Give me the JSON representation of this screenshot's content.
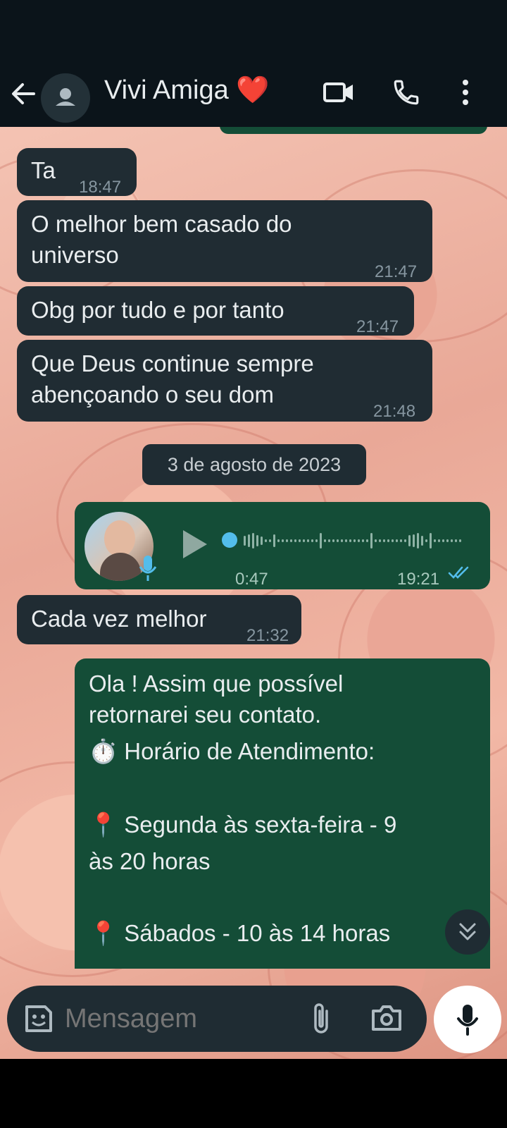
{
  "header": {
    "title": "Vivi Amiga",
    "title_emoji": "❤️"
  },
  "messages": [
    {
      "direction": "in",
      "text": "Ta",
      "time": "18:47"
    },
    {
      "direction": "in",
      "text_lines": [
        "O melhor bem casado do",
        "universo"
      ],
      "time": "21:47"
    },
    {
      "direction": "in",
      "text": "Obg por tudo e por tanto",
      "time": "21:47"
    },
    {
      "direction": "in",
      "text_lines": [
        "Que Deus continue sempre",
        "abençoando o seu dom"
      ],
      "time": "21:48"
    }
  ],
  "date_separator": "3 de agosto de 2023",
  "voice_message": {
    "direction": "out",
    "duration": "0:47",
    "time": "19:21",
    "status": "read"
  },
  "message_after_voice": {
    "direction": "in",
    "text": "Cada vez melhor",
    "time": "21:32"
  },
  "auto_reply": {
    "direction": "out",
    "lines": [
      "Ola ! Assim que possível",
      "retornarei seu contato.",
      "Horário de Atendimento:",
      "Segunda às sexta-feira - 9",
      "às 20 horas",
      "Sábados - 10 às 14 horas"
    ],
    "emojis": {
      "timer": "⏱️",
      "pin": "📍"
    }
  },
  "composer": {
    "placeholder": "Mensagem"
  },
  "icons": [
    "back-arrow-icon",
    "person-icon",
    "video-call-icon",
    "phone-icon",
    "more-vert-icon",
    "play-icon",
    "mic-badge-icon",
    "double-check-icon",
    "chevron-double-down-icon",
    "sticker-icon",
    "attach-icon",
    "camera-icon",
    "mic-icon"
  ],
  "colors": {
    "header_bg": "#0b141a",
    "incoming_bubble": "#202c33",
    "outgoing_bubble": "#144d37",
    "read_ticks": "#53bdeb",
    "text": "#e9edef"
  }
}
